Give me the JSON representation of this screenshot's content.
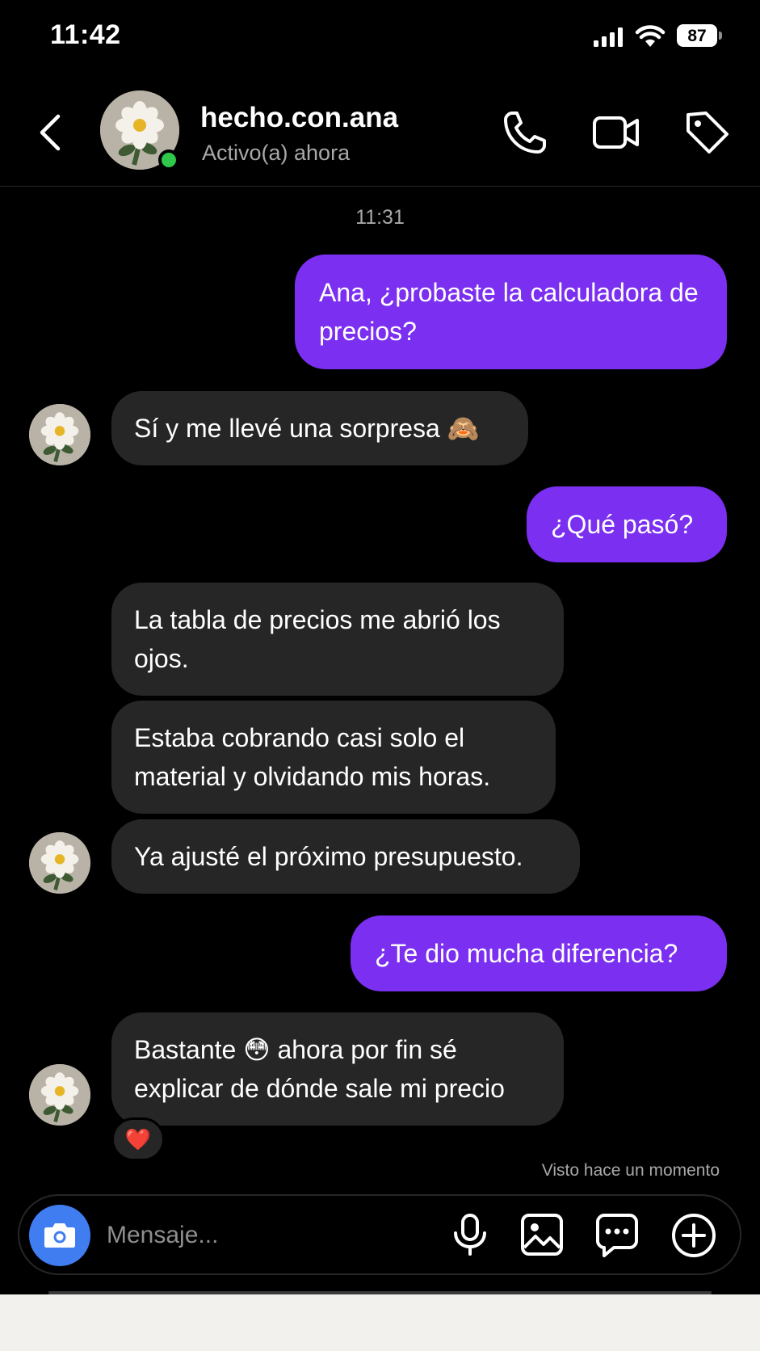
{
  "status_bar": {
    "time": "11:42",
    "battery": "87"
  },
  "header": {
    "name": "hecho.con.ana",
    "status": "Activo(a) ahora"
  },
  "chat": {
    "timestamp": "11:31",
    "messages": [
      {
        "from": "me",
        "text": "Ana, ¿probaste la calculadora de precios?"
      },
      {
        "from": "them",
        "text": "Sí y me llevé una sorpresa 🙈"
      },
      {
        "from": "me",
        "text": "¿Qué pasó?"
      },
      {
        "from": "them",
        "text": "La tabla de precios me abrió los ojos."
      },
      {
        "from": "them",
        "text": "Estaba cobrando casi solo el material y olvidando mis horas."
      },
      {
        "from": "them",
        "text": "Ya ajusté el próximo presupuesto."
      },
      {
        "from": "me",
        "text": "¿Te dio mucha diferencia?"
      },
      {
        "from": "them",
        "text": "Bastante 😳 ahora por fin sé explicar de dónde sale mi precio"
      }
    ],
    "reaction": "❤️",
    "seen": "Visto hace un momento"
  },
  "composer": {
    "placeholder": "Mensaje..."
  },
  "colors": {
    "sent_bubble": "#7b2ff0",
    "received_bubble": "#262626",
    "online": "#2fc84a",
    "camera_button": "#3f7df0"
  }
}
